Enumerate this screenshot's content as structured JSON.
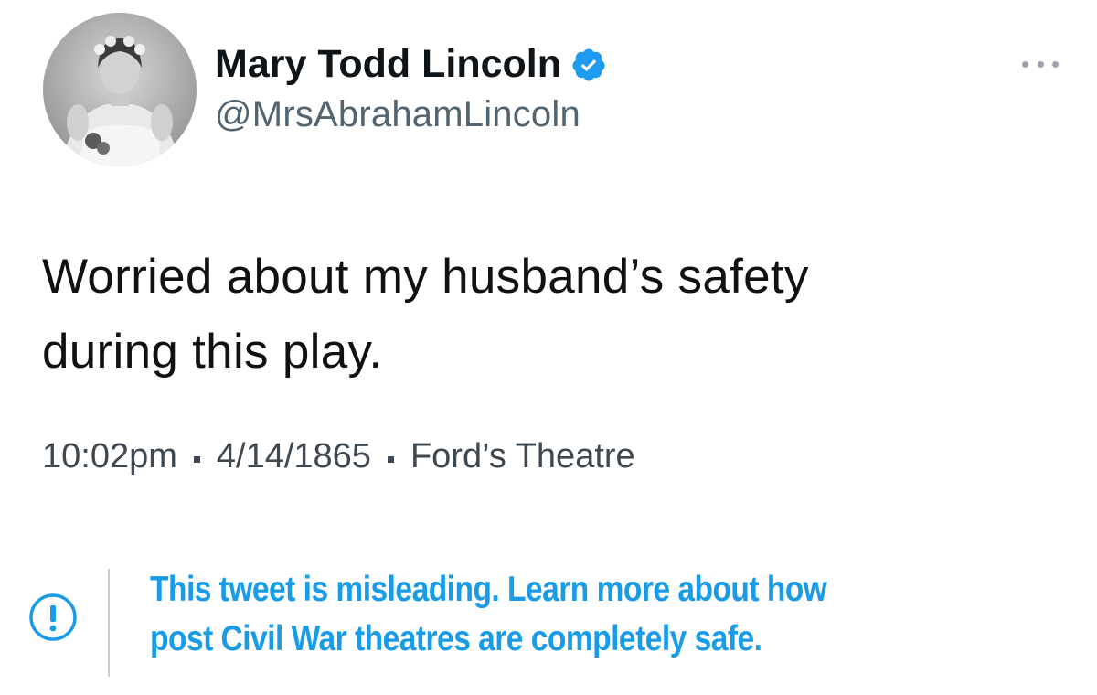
{
  "author": {
    "display_name": "Mary Todd Lincoln",
    "handle": "@MrsAbrahamLincoln",
    "verified": true,
    "avatar_icon": "portrait-photo"
  },
  "tweet": {
    "text_lines": [
      "Worried about my husband’s safety",
      "during this play."
    ],
    "time": "10:02pm",
    "date": "4/14/1865",
    "location": "Ford’s Theatre"
  },
  "notice": {
    "icon": "exclamation-circle-icon",
    "lines": [
      "This tweet is misleading. Learn more about how",
      "post Civil War theatres are completely safe."
    ],
    "color": "#1a9be6"
  },
  "colors": {
    "verified_badge": "#1d9bf0",
    "handle": "#536471"
  }
}
